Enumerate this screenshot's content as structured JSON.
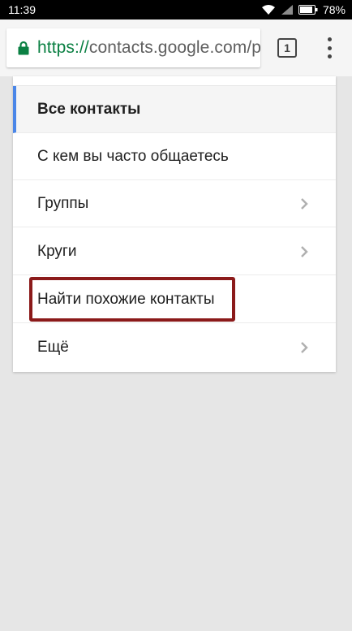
{
  "status_bar": {
    "time": "11:39",
    "battery": "78%"
  },
  "browser": {
    "url_scheme": "https://",
    "url_rest": "contacts.google.com/p",
    "tab_count": "1"
  },
  "menu": {
    "items": [
      {
        "label": "Все контакты",
        "active": true,
        "chevron": false
      },
      {
        "label": "С кем вы часто общаетесь",
        "active": false,
        "chevron": false
      },
      {
        "label": "Группы",
        "active": false,
        "chevron": true
      },
      {
        "label": "Круги",
        "active": false,
        "chevron": true
      },
      {
        "label": "Найти похожие контакты",
        "active": false,
        "chevron": false
      },
      {
        "label": "Ещё",
        "active": false,
        "chevron": true
      }
    ]
  },
  "colors": {
    "active_indicator": "#4a86e8",
    "highlight_box": "#8b1a1a",
    "url_scheme": "#0b8043"
  }
}
